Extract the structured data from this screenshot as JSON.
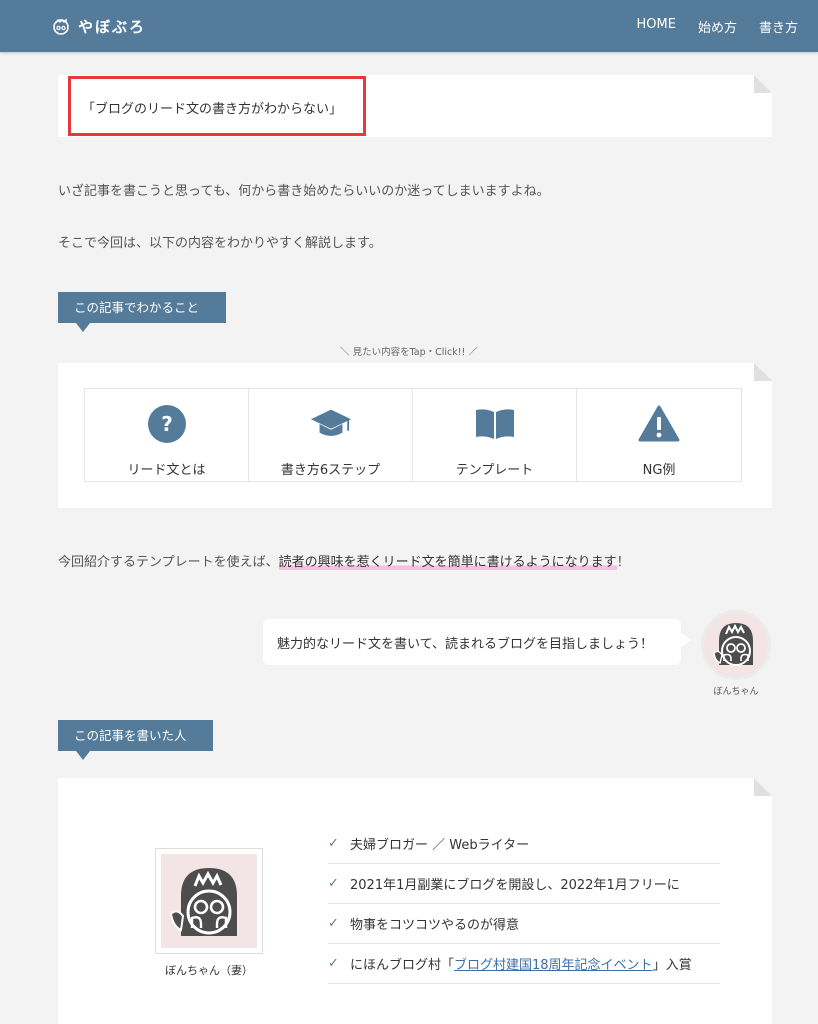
{
  "header": {
    "site_name": "やぼぶろ",
    "nav": [
      "HOME",
      "始め方",
      "書き方"
    ]
  },
  "lead": {
    "quote": "「ブログのリード文の書き方がわからない」"
  },
  "intro": {
    "p1": "いざ記事を書こうと思っても、何から書き始めたらいいのか迷ってしまいますよね。",
    "p2": "そこで今回は、以下の内容をわかりやすく解説します。"
  },
  "toc": {
    "tag": "この記事でわかること",
    "hint": "＼ 見たい内容をTap・Click!! ／",
    "items": [
      {
        "label": "リード文とは",
        "icon": "question-circle-icon"
      },
      {
        "label": "書き方6ステップ",
        "icon": "graduation-cap-icon"
      },
      {
        "label": "テンプレート",
        "icon": "book-open-icon"
      },
      {
        "label": "NG例",
        "icon": "warning-icon"
      }
    ]
  },
  "summary": {
    "before": "今回紹介するテンプレートを使えば、",
    "highlight": "読者の興味を惹くリード文を簡単に書けるようになります",
    "after": "！"
  },
  "speech": {
    "text": "魅力的なリード文を書いて、読まれるブログを目指しましょう！",
    "speaker": "ぼんちゃん"
  },
  "author": {
    "tag": "この記事を書いた人",
    "name": "ぼんちゃん（妻）",
    "points": [
      {
        "text": "夫婦ブロガー ／ Webライター"
      },
      {
        "text": "2021年1月副業にブログを開設し、2022年1月フリーに"
      },
      {
        "text": "物事をコツコツやるのが得意"
      }
    ],
    "last_point": {
      "prefix": "にほんブログ村「",
      "link": "ブログ村建国18周年記念イベント",
      "suffix": "」入賞"
    }
  },
  "colors": {
    "primary": "#557b9a",
    "highlight_border": "#e8383d",
    "marker": "#f6c1dc"
  }
}
